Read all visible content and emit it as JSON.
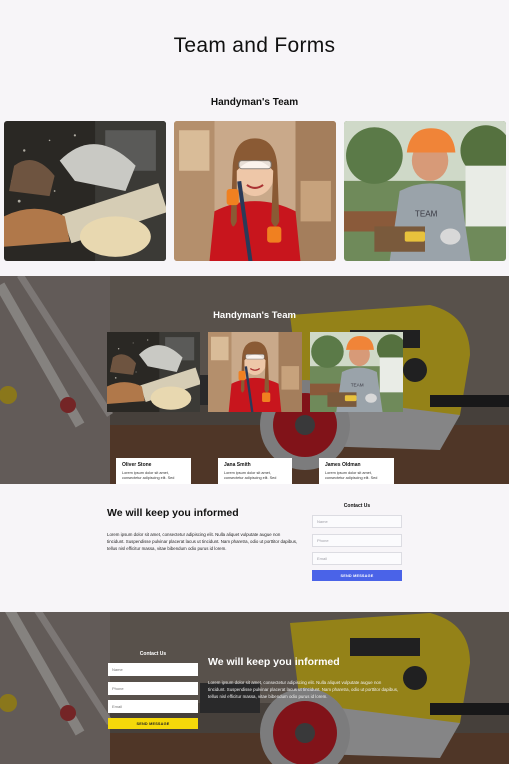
{
  "page": {
    "title": "Team and Forms"
  },
  "team_section": {
    "title": "Handyman's Team",
    "photos": [
      {
        "name": "worker-sawing-photo"
      },
      {
        "name": "woman-with-goggles-photo"
      },
      {
        "name": "worker-orange-helmet-photo"
      }
    ]
  },
  "hero_team_section": {
    "title": "Handyman's Team",
    "members": [
      {
        "name": "Oliver Stone",
        "text": "Lorem ipsum dolor sit amet, consectetur adipiscing elit. Sed"
      },
      {
        "name": "Jana Smith",
        "text": "Lorem ipsum dolor sit amet, consectetur adipiscing elit. Sed"
      },
      {
        "name": "James Oldman",
        "text": "Lorem ipsum dolor sit amet, consectetur adipiscing elit. Sed"
      }
    ]
  },
  "inform_section": {
    "title": "We will keep you informed",
    "text": "Lorem ipsum dolor sit amet, consectetur adipiscing elit. Nulla aliquet vulputate augue non tincidunt. Suspendisse pulvinar placerat lacus ut tincidunt. Nam pharetra, odio ut porttitor dapibus, tellus nisl efficitur massa, vitae bibendum odio purus id lorem.",
    "form": {
      "title": "Contact Us",
      "name_placeholder": "Name",
      "phone_placeholder": "Phone",
      "email_placeholder": "Email",
      "button_label": "SEND MESSAGE",
      "button_color": "#4a63e8"
    }
  },
  "hero_inform_section": {
    "title": "We will keep you informed",
    "text": "Lorem ipsum dolor sit amet, consectetur adipiscing elit. Nulla aliquet vulputate augue non tincidunt. Suspendisse pulvinar placerat lacus ut tincidunt. Nam pharetra, odio ut porttitor dapibus, tellus nisl efficitur massa, vitae bibendum odio purus id lorem.",
    "form": {
      "title": "Contact Us",
      "name_placeholder": "Name",
      "phone_placeholder": "Phone",
      "email_placeholder": "Email",
      "button_label": "SEND MESSAGE",
      "button_color": "#f5d90a"
    }
  },
  "colors": {
    "background": "#f7f5f8",
    "accent_blue": "#4a63e8",
    "accent_yellow": "#f5d90a",
    "overlay": "#141216"
  }
}
